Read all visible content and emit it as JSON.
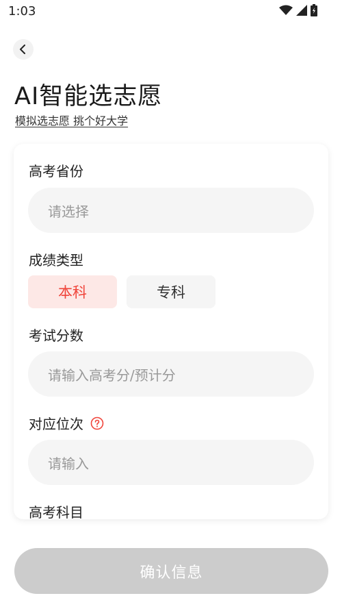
{
  "status_bar": {
    "time": "1:03",
    "icons": [
      "wifi-icon",
      "signal-icon",
      "battery-icon"
    ]
  },
  "header": {
    "title": "AI智能选志愿",
    "subtitle": "模拟选志愿 挑个好大学"
  },
  "form": {
    "province": {
      "label": "高考省份",
      "placeholder": "请选择"
    },
    "score_type": {
      "label": "成绩类型",
      "options": [
        "本科",
        "专科"
      ],
      "selected": "本科"
    },
    "exam_score": {
      "label": "考试分数",
      "placeholder": "请输入高考分/预计分"
    },
    "rank": {
      "label": "对应位次",
      "placeholder": "请输入"
    },
    "subjects": {
      "label": "高考科目"
    }
  },
  "footer": {
    "confirm_label": "确认信息"
  },
  "colors": {
    "accent": "#f0443a",
    "accent_bg": "#fde8e6",
    "input_bg": "#f5f5f5",
    "disabled_button": "#cccccc"
  }
}
